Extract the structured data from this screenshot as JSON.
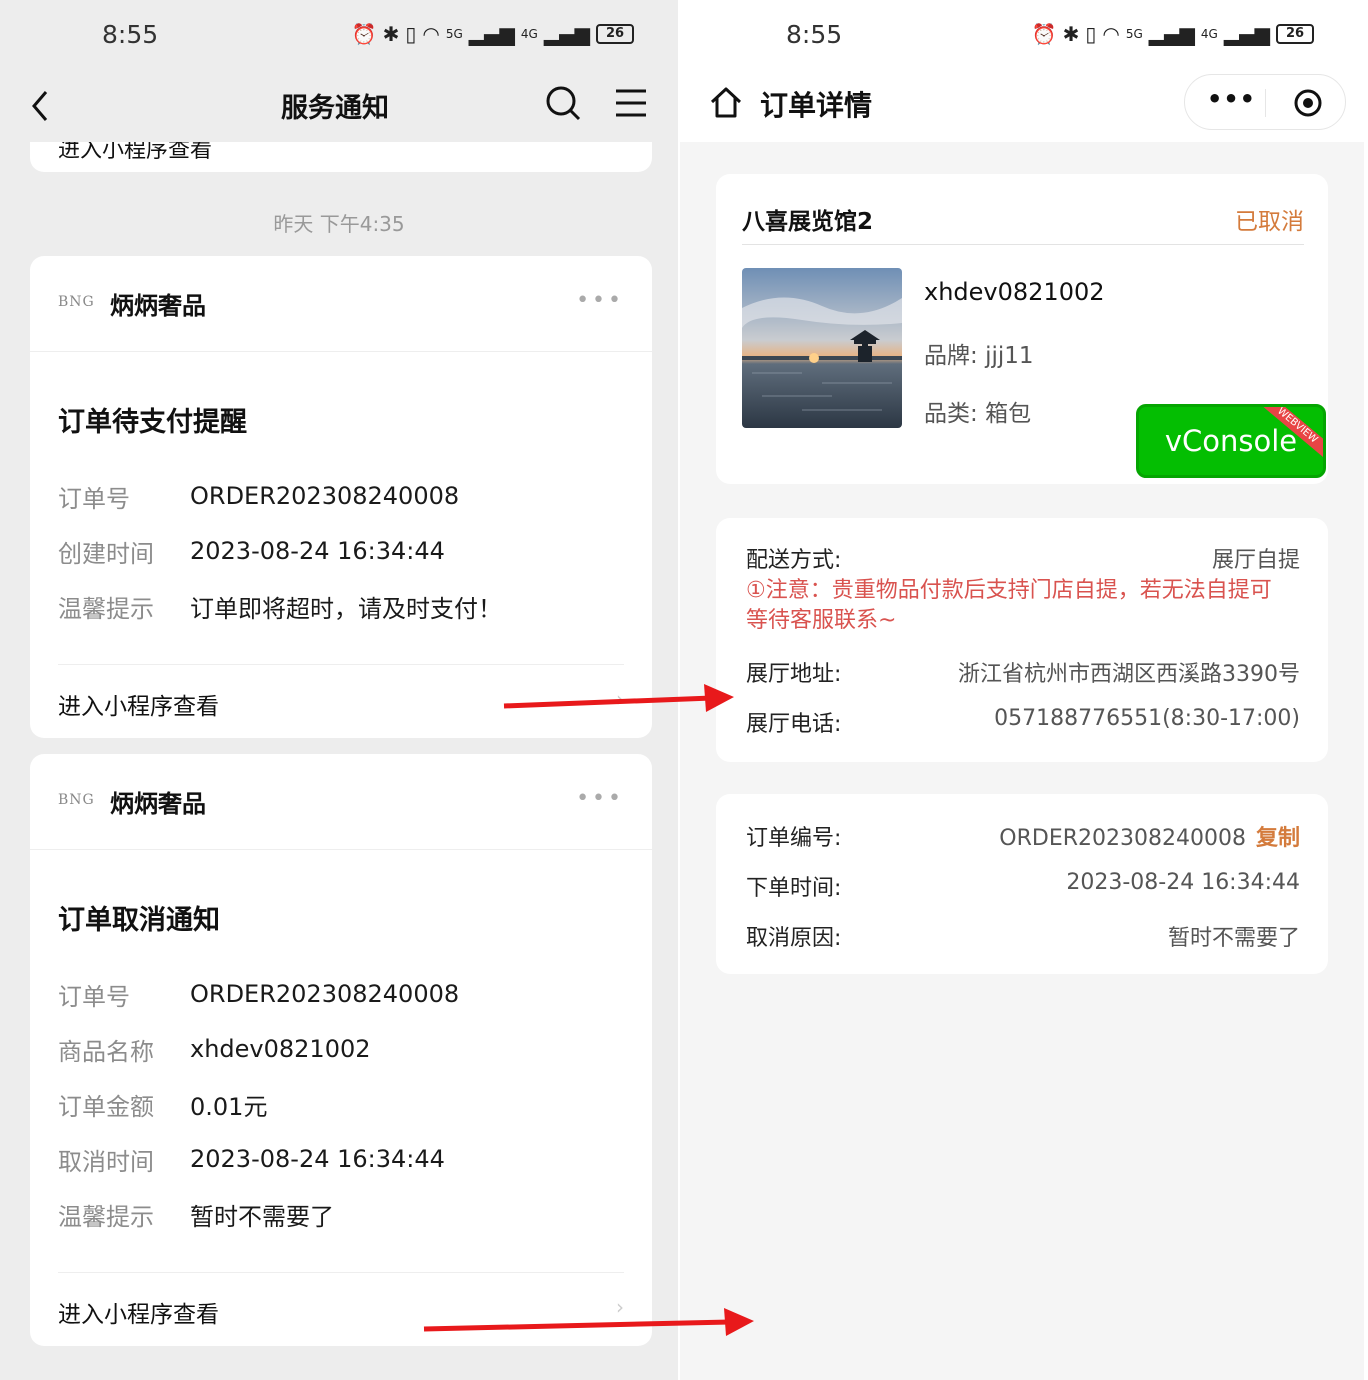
{
  "left_screen": {
    "status": {
      "time": "8:55",
      "battery": "26",
      "net1": "5G",
      "net2": "4G"
    },
    "nav": {
      "title": "服务通知"
    },
    "partial_card": {
      "footer": "进入小程序查看"
    },
    "timestamp": "昨天 下午4:35",
    "card1": {
      "brand_logo": "BNG",
      "brand_name": "炳炳奢品",
      "more": "•••",
      "title": "订单待支付提醒",
      "rows": [
        {
          "label": "订单号",
          "value": "ORDER202308240008"
        },
        {
          "label": "创建时间",
          "value": "2023-08-24 16:34:44"
        },
        {
          "label": "温馨提示",
          "value": "订单即将超时，请及时支付！"
        }
      ],
      "footer": "进入小程序查看"
    },
    "card2": {
      "brand_logo": "BNG",
      "brand_name": "炳炳奢品",
      "more": "•••",
      "title": "订单取消通知",
      "rows": [
        {
          "label": "订单号",
          "value": "ORDER202308240008"
        },
        {
          "label": "商品名称",
          "value": "xhdev0821002"
        },
        {
          "label": "订单金额",
          "value": "0.01元"
        },
        {
          "label": "取消时间",
          "value": "2023-08-24 16:34:44"
        },
        {
          "label": "温馨提示",
          "value": "暂时不需要了"
        }
      ],
      "footer": "进入小程序查看"
    }
  },
  "right_screen": {
    "status": {
      "time": "8:55",
      "battery": "26",
      "net1": "5G",
      "net2": "4G"
    },
    "nav": {
      "title": "订单详情",
      "capsule_dots": "•••"
    },
    "product_card": {
      "store_name": "八喜展览馆2",
      "status": "已取消",
      "product_name": "xhdev0821002",
      "brand_label": "品牌:",
      "brand_value": "jjj11",
      "category_label": "品类:",
      "category_value": "箱包"
    },
    "vconsole": {
      "label": "vConsole",
      "ribbon": "WEBVIEW"
    },
    "delivery_card": {
      "method_label": "配送方式:",
      "method_value": "展厅自提",
      "notice": "①注意：贵重物品付款后支持门店自提，若无法自提可等待客服联系~",
      "address_label": "展厅地址:",
      "address_value": "浙江省杭州市西湖区西溪路3390号",
      "phone_label": "展厅电话:",
      "phone_value": "057188776551(8:30-17:00)"
    },
    "order_card": {
      "number_label": "订单编号:",
      "number_value": "ORDER202308240008",
      "copy_label": "复制",
      "time_label": "下单时间:",
      "time_value": "2023-08-24 16:34:44",
      "reason_label": "取消原因:",
      "reason_value": "暂时不需要了"
    }
  },
  "colors": {
    "status_cancelled": "#d47b3c",
    "notice_red": "#d9534f",
    "vconsole_green": "#04be02",
    "annotation_arrow": "#e8191b"
  }
}
